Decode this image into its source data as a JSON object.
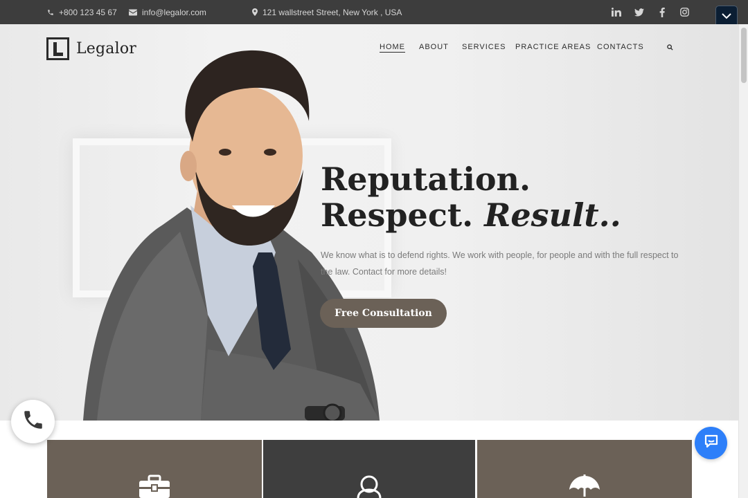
{
  "topbar": {
    "phone": "+800 123 45 67",
    "email": "info@legalor.com",
    "address": "121 wallstreet Street, New York , USA",
    "social": [
      "linkedin-icon",
      "twitter-icon",
      "facebook-icon",
      "instagram-icon"
    ],
    "background": "#3d3d3d"
  },
  "logo": {
    "name": "Legalor"
  },
  "nav": {
    "items": [
      "HOME",
      "ABOUT",
      "SERVICES",
      "PRACTICE AREAS",
      "CONTACTS"
    ],
    "active": "HOME"
  },
  "hero": {
    "headline_line1": "Reputation.",
    "headline_line2_plain": "Respect.",
    "headline_line2_italic": "Result..",
    "subtext": "We know what is to defend rights. We work with people, for people and with the full respect to the law. Contact for more details!",
    "cta_label": "Free Consultation"
  },
  "cards": [
    {
      "icon": "briefcase-icon",
      "color": "#6b6157"
    },
    {
      "icon": "user-icon",
      "color": "#3e3e3e"
    },
    {
      "icon": "umbrella-icon",
      "color": "#6b6157"
    }
  ],
  "colors": {
    "accent": "#6b6157",
    "dark": "#3e3e3e",
    "chat": "#2d7ff9",
    "dropdown": "#0b1e33"
  }
}
